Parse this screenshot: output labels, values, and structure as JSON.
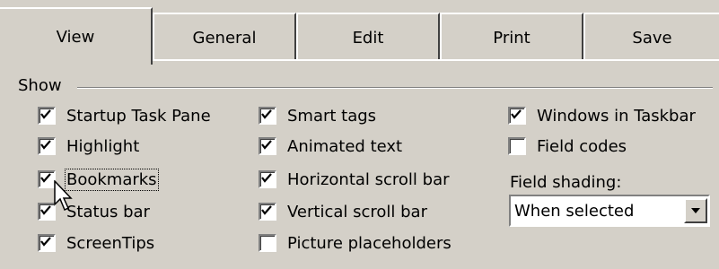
{
  "tabs": [
    {
      "label": "View",
      "active": true
    },
    {
      "label": "General",
      "active": false
    },
    {
      "label": "Edit",
      "active": false
    },
    {
      "label": "Print",
      "active": false
    },
    {
      "label": "Save",
      "active": false
    }
  ],
  "group": {
    "label": "Show"
  },
  "col1": [
    {
      "label": "Startup Task Pane",
      "checked": true
    },
    {
      "label": "Highlight",
      "checked": true
    },
    {
      "label": "Bookmarks",
      "checked": true,
      "focused": true
    },
    {
      "label": "Status bar",
      "checked": true
    },
    {
      "label": "ScreenTips",
      "checked": true
    }
  ],
  "col2": [
    {
      "label": "Smart tags",
      "checked": true
    },
    {
      "label": "Animated text",
      "checked": true
    },
    {
      "label": "Horizontal scroll bar",
      "checked": true
    },
    {
      "label": "Vertical scroll bar",
      "checked": true
    },
    {
      "label": "Picture placeholders",
      "checked": false
    }
  ],
  "col3": [
    {
      "label": "Windows in Taskbar",
      "checked": true
    },
    {
      "label": "Field codes",
      "checked": false
    }
  ],
  "field_shading": {
    "label": "Field shading:",
    "value": "When selected"
  },
  "icons": {
    "check": "check-icon",
    "dropdown": "dropdown-arrow-icon",
    "cursor": "mouse-pointer-icon"
  },
  "colors": {
    "face": "#d4d0c8",
    "highlight": "#ffffff",
    "shadow": "#808080"
  }
}
